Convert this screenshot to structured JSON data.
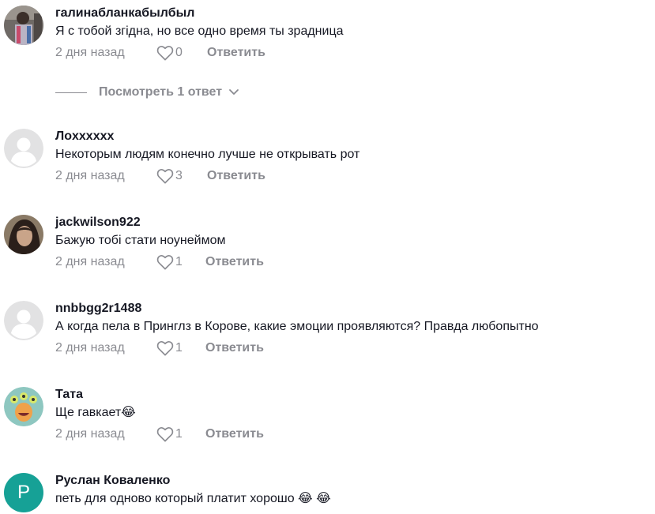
{
  "colors": {
    "text": "#161823",
    "muted": "#8a8b91",
    "letter_avatar_bg": "#16a196"
  },
  "comments": [
    {
      "username": "галинабланкабылбыл",
      "text": "Я с тобой згідна, но все одно время ты зрадница",
      "time": "2 дня назад",
      "likes": "0",
      "reply": "Ответить",
      "avatar": "photo"
    },
    {
      "username": "Лоxxxxxx",
      "text": "Некоторым людям конечно лучше не открывать рот",
      "time": "2 дня назад",
      "likes": "3",
      "reply": "Ответить",
      "avatar": "default-user-icon"
    },
    {
      "username": "jackwilson922",
      "text": "Бажую тобі стати ноунеймом",
      "time": "2 дня назад",
      "likes": "1",
      "reply": "Ответить",
      "avatar": "photo"
    },
    {
      "username": "nnbbgg2r1488",
      "text": "А когда пела в Принглз в Корове, какие эмоции проявляются? Правда любопытно",
      "time": "2 дня назад",
      "likes": "1",
      "reply": "Ответить",
      "avatar": "default-user-icon"
    },
    {
      "username": "Тата",
      "text": "Ще гавкает😂",
      "time": "2 дня назад",
      "likes": "1",
      "reply": "Ответить",
      "avatar": "cartoon-monster"
    },
    {
      "username": "Руслан Коваленко",
      "text": "петь для одново который платит хорошо 😂 😂",
      "avatar_letter": "P",
      "avatar": "letter"
    }
  ],
  "view_replies": {
    "label": "Посмотреть 1 ответ",
    "icon": "chevron-down-icon"
  }
}
